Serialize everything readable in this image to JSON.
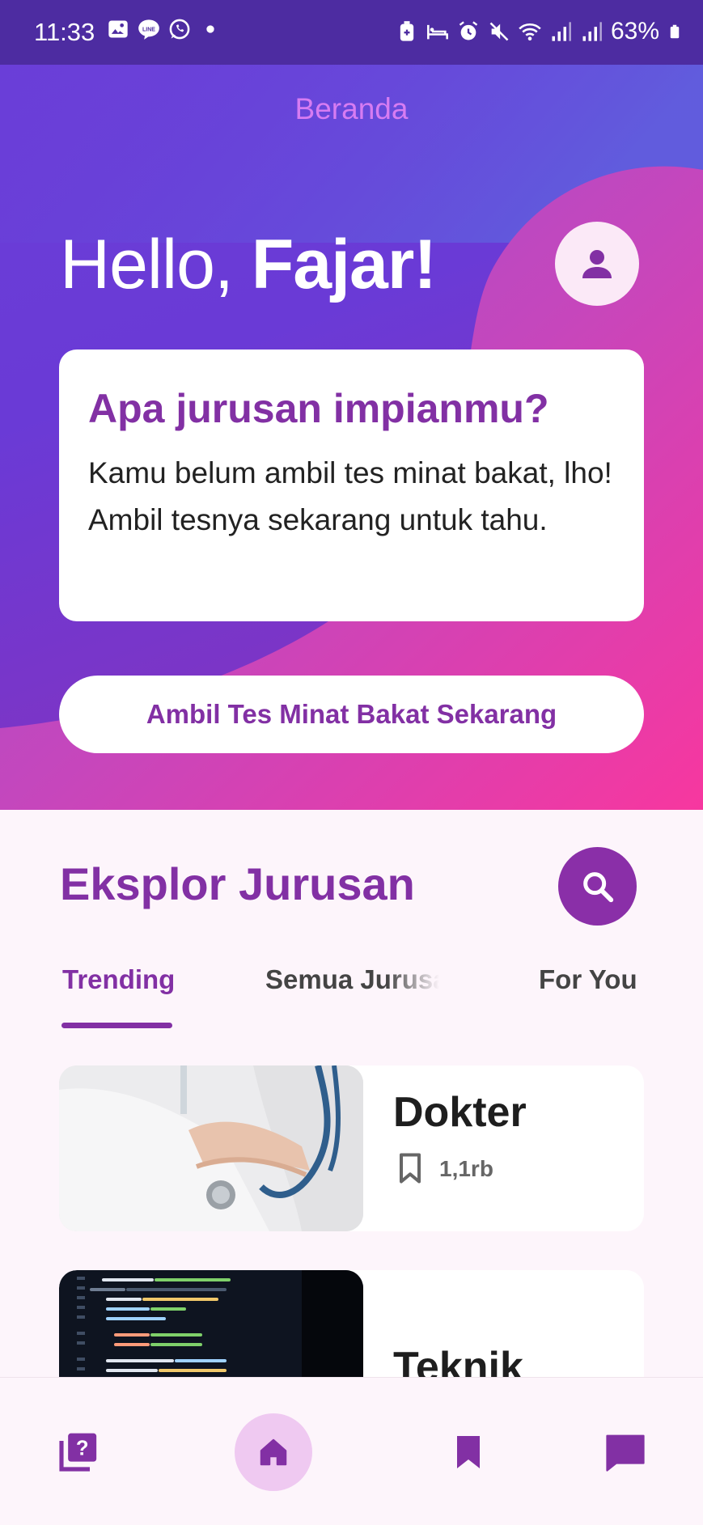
{
  "status_bar": {
    "time": "11:33",
    "battery": "63%",
    "icons_left": [
      "gallery-icon",
      "line-icon",
      "whatsapp-icon",
      "dot-icon"
    ],
    "icons_right": [
      "battery-saver-icon",
      "sleep-icon",
      "alarm-icon",
      "mute-icon",
      "wifi-icon",
      "signal-icon",
      "signal-icon",
      "battery-icon"
    ]
  },
  "header": {
    "title": "Beranda"
  },
  "greeting": {
    "prefix": "Hello, ",
    "name": "Fajar!"
  },
  "promo_card": {
    "title": "Apa jurusan impianmu?",
    "body": "Kamu belum ambil tes minat bakat, lho! Ambil tesnya sekarang untuk tahu."
  },
  "cta": {
    "label": "Ambil Tes Minat Bakat Sekarang"
  },
  "explore": {
    "title": "Eksplor Jurusan",
    "tabs": [
      {
        "label": "Trending",
        "active": true
      },
      {
        "label": "Semua Jurusan",
        "active": false
      },
      {
        "label": "For You",
        "active": false
      }
    ],
    "items": [
      {
        "name": "Dokter",
        "bookmarks": "1,1rb"
      },
      {
        "name": "Teknik"
      }
    ]
  },
  "bottom_nav": {
    "items": [
      "quiz-icon",
      "home-icon",
      "bookmark-icon",
      "chat-icon"
    ],
    "active": "home-icon"
  },
  "colors": {
    "primary": "#8230a4",
    "status_bar": "#4d2ca1",
    "accent_pink": "#f03a9e",
    "background": "#fdf5fb"
  }
}
